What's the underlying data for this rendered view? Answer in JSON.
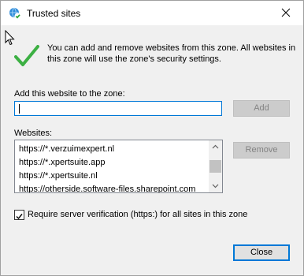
{
  "window": {
    "title": "Trusted sites"
  },
  "info": {
    "message": "You can add and remove websites from this zone. All websites in this zone will use the zone's security settings."
  },
  "add_site": {
    "label": "Add this website to the zone:",
    "value": "",
    "add_button": "Add"
  },
  "websites": {
    "label": "Websites:",
    "items": [
      "https://*.verzuimexpert.nl",
      "https://*.xpertsuite.app",
      "https://*.xpertsuite.nl",
      "https://otherside.software-files.sharepoint.com"
    ],
    "remove_button": "Remove"
  },
  "options": {
    "require_https_label": "Require server verification (https:) for all sites in this zone",
    "require_https_checked": true
  },
  "footer": {
    "close_button": "Close"
  },
  "icons": {
    "app": "globe-check-icon",
    "close": "close-icon",
    "status": "green-check-icon",
    "pointer": "mouse-cursor-icon"
  },
  "colors": {
    "accent": "#0078d7",
    "check_green": "#3cb043",
    "disabled_button": "#cccccc",
    "dialog_bg": "#f0f0f0"
  }
}
